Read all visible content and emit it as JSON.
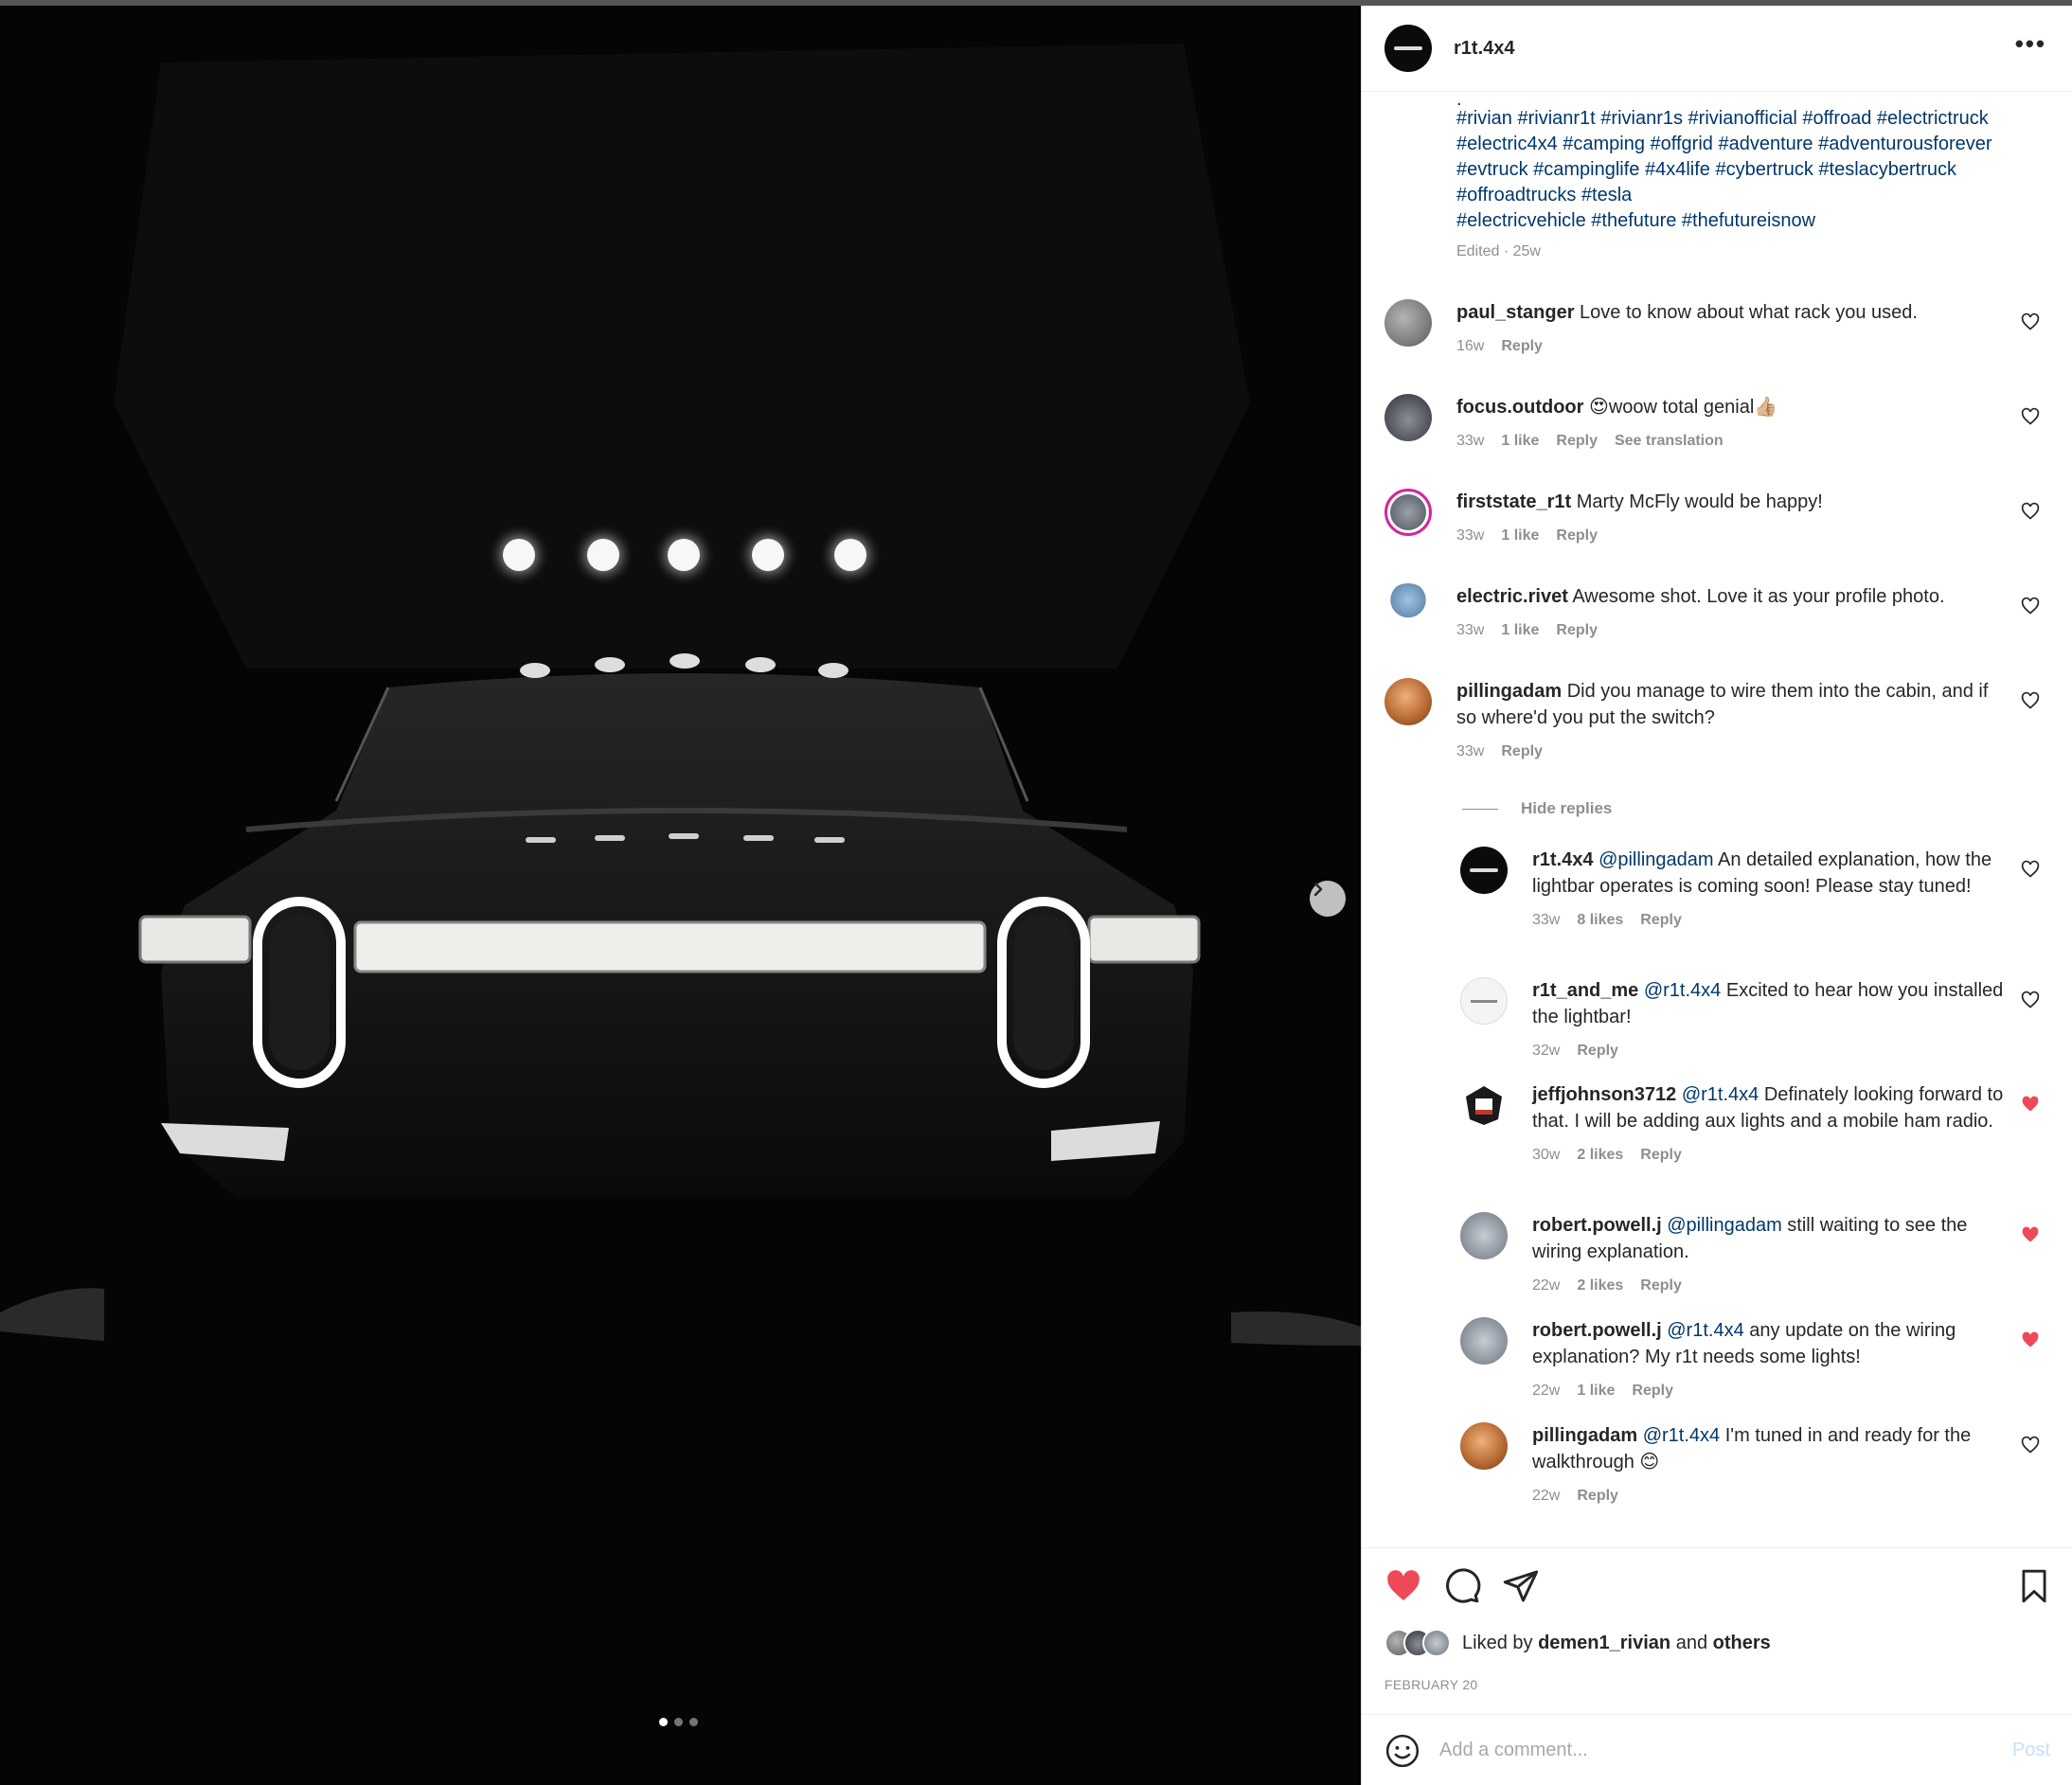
{
  "post": {
    "username": "r1t.4x4",
    "more_label": "•••",
    "caption_lines": [
      ".",
      "#rivian #rivianr1t #rivianr1s #rivianofficial #offroad #electrictruck",
      "#electric4x4 #camping #offgrid #adventure #adventurousforever",
      "#evtruck #campinglife #4x4life #cybertruck #teslacybertruck",
      "#offroadtrucks #tesla",
      "#electricvehicle #thefuture #thefutureisnow"
    ],
    "caption_meta": "Edited · 25w"
  },
  "comments": [
    {
      "user": "paul_stanger",
      "text": "Love to know about what rack you used.",
      "time": "16w",
      "likes": "",
      "reply": "Reply",
      "extra": "",
      "liked": false
    },
    {
      "user": "focus.outdoor",
      "text": "😍woow total genial👍🏼",
      "time": "33w",
      "likes": "1 like",
      "reply": "Reply",
      "extra": "See translation",
      "liked": false
    },
    {
      "user": "firststate_r1t",
      "text": "Marty McFly would be happy!",
      "time": "33w",
      "likes": "1 like",
      "reply": "Reply",
      "extra": "",
      "liked": false
    },
    {
      "user": "electric.rivet",
      "text": "Awesome shot. Love it as your profile photo.",
      "time": "33w",
      "likes": "1 like",
      "reply": "Reply",
      "extra": "",
      "liked": false
    },
    {
      "user": "pillingadam",
      "text": "Did you manage to wire them into the cabin, and if so where'd you put the switch?",
      "time": "33w",
      "likes": "",
      "reply": "Reply",
      "extra": "",
      "liked": false
    }
  ],
  "hide_replies": "Hide replies",
  "replies": [
    {
      "user": "r1t.4x4",
      "mention": "@pillingadam",
      "text": "An detailed explanation, how the lightbar operates is coming soon! Please stay tuned!",
      "time": "33w",
      "likes": "8 likes",
      "reply": "Reply",
      "liked": false
    },
    {
      "user": "r1t_and_me",
      "mention": "@r1t.4x4",
      "text": "Excited to hear how you installed the lightbar!",
      "time": "32w",
      "likes": "",
      "reply": "Reply",
      "liked": false
    },
    {
      "user": "jeffjohnson3712",
      "mention": "@r1t.4x4",
      "text": "Definately looking forward to that. I will be adding aux lights and a mobile ham radio.",
      "time": "30w",
      "likes": "2 likes",
      "reply": "Reply",
      "liked": true
    },
    {
      "user": "robert.powell.j",
      "mention": "@pillingadam",
      "text": "still waiting to see the wiring explanation.",
      "time": "22w",
      "likes": "2 likes",
      "reply": "Reply",
      "liked": true
    },
    {
      "user": "robert.powell.j",
      "mention": "@r1t.4x4",
      "text": "any update on the wiring explanation? My r1t needs some lights!",
      "time": "22w",
      "likes": "1 like",
      "reply": "Reply",
      "liked": true
    },
    {
      "user": "pillingadam",
      "mention": "@r1t.4x4",
      "text": "I'm tuned in and ready for the walkthrough 😊",
      "time": "22w",
      "likes": "",
      "reply": "Reply",
      "liked": false
    }
  ],
  "footer": {
    "liked_by_prefix": "Liked by",
    "liked_by_user": "demen1_rivian",
    "liked_by_and": "and",
    "liked_by_others": "others",
    "date": "FEBRUARY 20",
    "comment_placeholder": "Add a comment...",
    "post_label": "Post"
  },
  "icons": {
    "like": "heart-filled-icon",
    "comment": "comment-bubble-icon",
    "share": "paper-plane-icon",
    "save": "bookmark-icon",
    "emoji": "smiley-icon",
    "next": "chevron-right-icon"
  },
  "colors": {
    "liked_red": "#ed4956",
    "link_blue": "#00376b",
    "muted": "#8e8e8e",
    "post_button": "#c7dff7"
  },
  "carousel": {
    "count": 3,
    "active": 0
  }
}
